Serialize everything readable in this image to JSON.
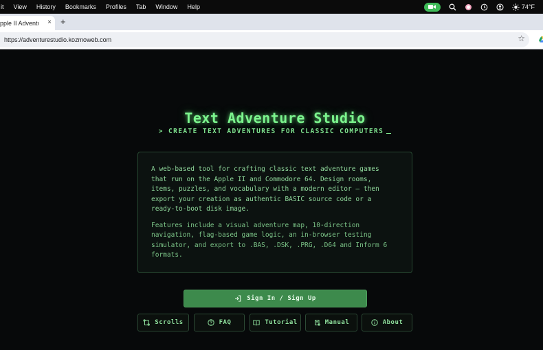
{
  "menubar": {
    "items": [
      "it",
      "View",
      "History",
      "Bookmarks",
      "Profiles",
      "Tab",
      "Window",
      "Help"
    ],
    "temperature": "74°F",
    "icons": [
      "facetime-video-icon",
      "search-icon",
      "profile-dot-icon",
      "time-machine-icon",
      "user-circle-icon",
      "sun-icon"
    ]
  },
  "browser": {
    "tab_title": "Apple II Adventure St",
    "tab_close": "×",
    "new_tab": "+",
    "url": "https://adventurestudio.kozmoweb.com",
    "bookmark_icon": "star-icon"
  },
  "page": {
    "title": "Text Adventure Studio",
    "subtitle": "> CREATE TEXT ADVENTURES FOR CLASSIC COMPUTERS",
    "description_1": "A web-based tool for crafting classic text adventure games that run on the Apple II and Commodore 64. Design rooms, items, puzzles, and vocabulary with a modern editor — then export your creation as authentic BASIC source code or a ready-to-boot disk image.",
    "description_2": "Features include a visual adventure map, 10-direction navigation, flag-based game logic, an in-browser testing simulator, and export to .BAS, .DSK, .PRG, .D64 and Inform 6 formats.",
    "signin_label": "Sign In / Sign Up",
    "nav": {
      "scrolls": "Scrolls",
      "faq": "FAQ",
      "tutorial": "Tutorial",
      "manual": "Manual",
      "about": "About"
    }
  },
  "colors": {
    "accent": "#7cf58e",
    "button_green": "#3d8a4c",
    "background": "#07090a"
  }
}
